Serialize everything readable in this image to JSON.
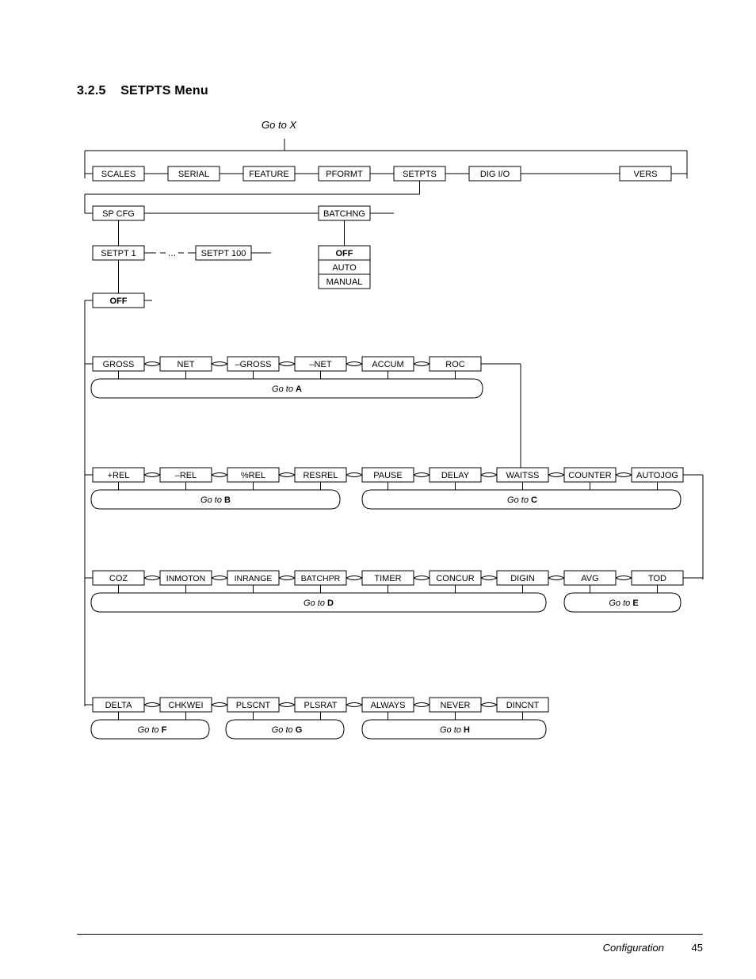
{
  "heading_number": "3.2.5",
  "heading_title": "SETPTS Menu",
  "goto_x": "Go to X",
  "top_row": [
    "SCALES",
    "SERIAL",
    "FEATURE",
    "PFORMT",
    "SETPTS",
    "DIG I/O",
    "VERS"
  ],
  "row2": {
    "left": "SP CFG",
    "right": "BATCHNG"
  },
  "row3": {
    "a": "SETPT 1",
    "dots": "…",
    "b": "SETPT 100"
  },
  "batchng_opts": [
    "OFF",
    "AUTO",
    "MANUAL"
  ],
  "setpt_off": "OFF",
  "group_a": [
    "GROSS",
    "NET",
    "–GROSS",
    "–NET",
    "ACCUM",
    "ROC"
  ],
  "goto_a": "A",
  "group_b": [
    "+REL",
    "–REL",
    "%REL",
    "RESREL"
  ],
  "goto_b": "B",
  "group_c": [
    "PAUSE",
    "DELAY",
    "WAITSS",
    "COUNTER",
    "AUTOJOG"
  ],
  "goto_c": "C",
  "group_d": [
    "COZ",
    "INMOTON",
    "INRANGE",
    "BATCHPR",
    "TIMER",
    "CONCUR",
    "DIGIN"
  ],
  "goto_d": "D",
  "group_e": [
    "AVG",
    "TOD"
  ],
  "goto_e": "E",
  "group_f": [
    "DELTA",
    "CHKWEI"
  ],
  "goto_f": "F",
  "group_g": [
    "PLSCNT",
    "PLSRAT"
  ],
  "goto_g": "G",
  "group_h": [
    "ALWAYS",
    "NEVER",
    "DINCNT"
  ],
  "goto_h": "H",
  "footer_section": "Configuration",
  "footer_page": "45"
}
